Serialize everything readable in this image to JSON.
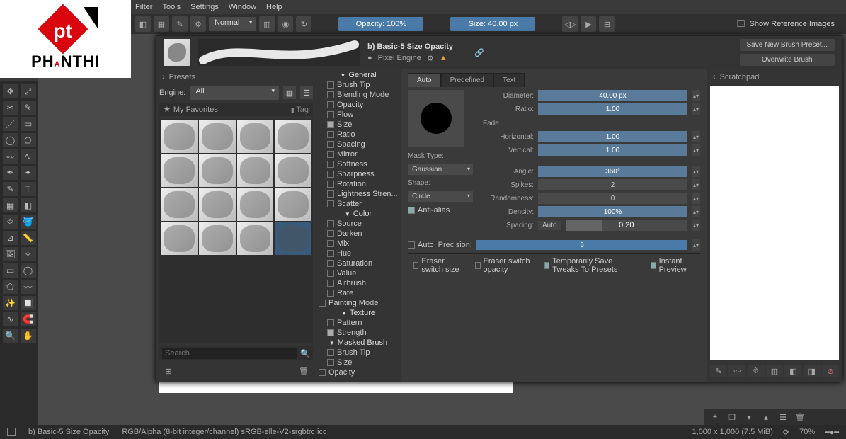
{
  "menu": {
    "items": [
      "Filter",
      "Tools",
      "Settings",
      "Window",
      "Help"
    ]
  },
  "topbar": {
    "blend": "Normal",
    "opacity": "Opacity: 100%",
    "size": "Size: 40.00 px",
    "refimg": "Show Reference Images"
  },
  "logo": {
    "word": "PHANTHI"
  },
  "dialog": {
    "title": "b) Basic-5 Size Opacity",
    "engine_label": "Pixel Engine",
    "save_preset": "Save New Brush Preset...",
    "overwrite": "Overwrite Brush"
  },
  "presets": {
    "header": "Presets",
    "engine_label": "Engine:",
    "engine_value": "All",
    "favorites": "My Favorites",
    "tag": "Tag",
    "search_ph": "Search"
  },
  "tree": [
    {
      "t": "cat",
      "label": "General"
    },
    {
      "t": "item",
      "label": "Brush Tip",
      "ck": false
    },
    {
      "t": "item",
      "label": "Blending Mode",
      "ck": false
    },
    {
      "t": "item",
      "label": "Opacity",
      "ck": false
    },
    {
      "t": "item",
      "label": "Flow",
      "ck": false
    },
    {
      "t": "item",
      "label": "Size",
      "ck": true
    },
    {
      "t": "item",
      "label": "Ratio",
      "ck": false
    },
    {
      "t": "item",
      "label": "Spacing",
      "ck": false
    },
    {
      "t": "item",
      "label": "Mirror",
      "ck": false
    },
    {
      "t": "item",
      "label": "Softness",
      "ck": false
    },
    {
      "t": "item",
      "label": "Sharpness",
      "ck": false
    },
    {
      "t": "item",
      "label": "Rotation",
      "ck": false
    },
    {
      "t": "item",
      "label": "Lightness Stren...",
      "ck": false
    },
    {
      "t": "item",
      "label": "Scatter",
      "ck": false
    },
    {
      "t": "cat",
      "label": "Color"
    },
    {
      "t": "item",
      "label": "Source",
      "ck": false
    },
    {
      "t": "item",
      "label": "Darken",
      "ck": false
    },
    {
      "t": "item",
      "label": "Mix",
      "ck": false
    },
    {
      "t": "item",
      "label": "Hue",
      "ck": false
    },
    {
      "t": "item",
      "label": "Saturation",
      "ck": false
    },
    {
      "t": "item",
      "label": "Value",
      "ck": false
    },
    {
      "t": "item",
      "label": "Airbrush",
      "ck": false
    },
    {
      "t": "item",
      "label": "Rate",
      "ck": false
    },
    {
      "t": "item",
      "label": "Painting Mode",
      "ck": false,
      "noindent": true
    },
    {
      "t": "cat",
      "label": "Texture"
    },
    {
      "t": "item",
      "label": "Pattern",
      "ck": false
    },
    {
      "t": "item",
      "label": "Strength",
      "ck": true
    },
    {
      "t": "cat",
      "label": "Masked Brush"
    },
    {
      "t": "item",
      "label": "Brush Tip",
      "ck": false
    },
    {
      "t": "item",
      "label": "Size",
      "ck": false
    },
    {
      "t": "item",
      "label": "Opacity",
      "ck": false,
      "noindent": true
    }
  ],
  "settings": {
    "tabs": [
      "Auto",
      "Predefined",
      "Text"
    ],
    "diameter_l": "Diameter:",
    "diameter_v": "40.00 px",
    "ratio_l": "Ratio:",
    "ratio_v": "1.00",
    "fade_l": "Fade",
    "horiz_l": "Horizontal:",
    "horiz_v": "1.00",
    "vert_l": "Vertical:",
    "vert_v": "1.00",
    "mask_l": "Mask Type:",
    "mask_v": "Gaussian",
    "shape_l": "Shape:",
    "shape_v": "Circle",
    "aa_l": "Anti-alias",
    "angle_l": "Angle:",
    "angle_v": "360°",
    "spikes_l": "Spikes:",
    "spikes_v": "2",
    "rand_l": "Randomness:",
    "rand_v": "0",
    "density_l": "Density:",
    "density_v": "100%",
    "spacing_l": "Spacing:",
    "spacing_auto": "Auto",
    "spacing_v": "0.20",
    "precision_auto": "Auto",
    "precision_l": "Precision:",
    "precision_v": "5"
  },
  "footer": {
    "eraser_size": "Eraser switch size",
    "eraser_opacity": "Eraser switch opacity",
    "temp_save": "Temporarily Save Tweaks To Presets",
    "instant": "Instant Preview"
  },
  "scratch": {
    "title": "Scratchpad"
  },
  "bottom_strip": {
    "zoom": "70%"
  },
  "status": {
    "preset": "b) Basic-5 Size Opacity",
    "profile": "RGB/Alpha (8-bit integer/channel)  sRGB-elle-V2-srgbtrc.icc",
    "dims": "1,000 x 1,000 (7.5 MiB)"
  }
}
